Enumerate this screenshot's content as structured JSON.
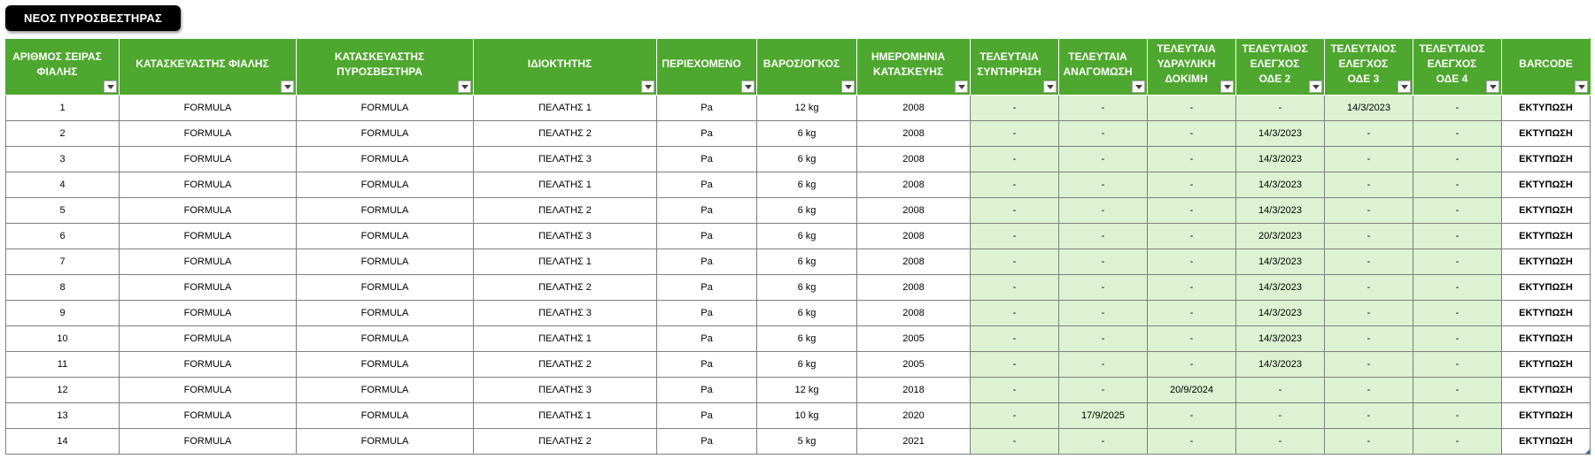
{
  "toolbar": {
    "new_button_label": "ΝΕΟΣ ΠΥΡΟΣΒΕΣΤΗΡΑΣ"
  },
  "colors": {
    "header_bg": "#4ea72e",
    "header_text": "#ffffff",
    "highlight_cell_bg": "#dcf2d0",
    "grid_line": "#7f7f7f",
    "button_bg": "#000000"
  },
  "icons": {
    "filter": "filter-dropdown-icon"
  },
  "table": {
    "columns": [
      "ΑΡΙΘΜΟΣ ΣΕΙΡΑΣ ΦΙΑΛΗΣ",
      "ΚΑΤΑΣΚΕΥΑΣΤΗΣ ΦΙΑΛΗΣ",
      "ΚΑΤΑΣΚΕΥΑΣΤΗΣ ΠΥΡΟΣΒΕΣΤΗΡΑ",
      "ΙΔΙΟΚΤΗΤΗΣ",
      "ΠΕΡΙΕΧΟΜΕΝΟ",
      "ΒΑΡΟΣ/ΟΓΚΟΣ",
      "ΗΜΕΡΟΜΗΝΙΑ ΚΑΤΑΣΚΕΥΗΣ",
      "ΤΕΛΕΥΤΑΙΑ ΣΥΝΤΗΡΗΣΗ",
      "ΤΕΛΕΥΤΑΙΑ ΑΝΑΓΟΜΩΣΗ",
      "ΤΕΛΕΥΤΑΙΑ ΥΔΡΑΥΛΙΚΗ ΔΟΚΙΜΗ",
      "ΤΕΛΕΥΤΑΙΟΣ ΕΛΕΓΧΟΣ ΟΔΕ 2",
      "ΤΕΛΕΥΤΑΙΟΣ ΕΛΕΓΧΟΣ ΟΔΕ 3",
      "ΤΕΛΕΥΤΑΙΟΣ ΕΛΕΓΧΟΣ ΟΔΕ 4",
      "BARCODE"
    ],
    "rows": [
      [
        "1",
        "FORMULA",
        "FORMULA",
        "ΠΕΛΑΤΗΣ 1",
        "Pa",
        "12 kg",
        "2008",
        "-",
        "-",
        "-",
        "-",
        "14/3/2023",
        "-",
        "ΕΚΤΥΠΩΣΗ"
      ],
      [
        "2",
        "FORMULA",
        "FORMULA",
        "ΠΕΛΑΤΗΣ 2",
        "Pa",
        "6 kg",
        "2008",
        "-",
        "-",
        "-",
        "14/3/2023",
        "-",
        "-",
        "ΕΚΤΥΠΩΣΗ"
      ],
      [
        "3",
        "FORMULA",
        "FORMULA",
        "ΠΕΛΑΤΗΣ 3",
        "Pa",
        "6 kg",
        "2008",
        "-",
        "-",
        "-",
        "14/3/2023",
        "-",
        "-",
        "ΕΚΤΥΠΩΣΗ"
      ],
      [
        "4",
        "FORMULA",
        "FORMULA",
        "ΠΕΛΑΤΗΣ 1",
        "Pa",
        "6 kg",
        "2008",
        "-",
        "-",
        "-",
        "14/3/2023",
        "-",
        "-",
        "ΕΚΤΥΠΩΣΗ"
      ],
      [
        "5",
        "FORMULA",
        "FORMULA",
        "ΠΕΛΑΤΗΣ 2",
        "Pa",
        "6 kg",
        "2008",
        "-",
        "-",
        "-",
        "14/3/2023",
        "-",
        "-",
        "ΕΚΤΥΠΩΣΗ"
      ],
      [
        "6",
        "FORMULA",
        "FORMULA",
        "ΠΕΛΑΤΗΣ 3",
        "Pa",
        "6 kg",
        "2008",
        "-",
        "-",
        "-",
        "20/3/2023",
        "-",
        "-",
        "ΕΚΤΥΠΩΣΗ"
      ],
      [
        "7",
        "FORMULA",
        "FORMULA",
        "ΠΕΛΑΤΗΣ 1",
        "Pa",
        "6 kg",
        "2008",
        "-",
        "-",
        "-",
        "14/3/2023",
        "-",
        "-",
        "ΕΚΤΥΠΩΣΗ"
      ],
      [
        "8",
        "FORMULA",
        "FORMULA",
        "ΠΕΛΑΤΗΣ 2",
        "Pa",
        "6 kg",
        "2008",
        "-",
        "-",
        "-",
        "14/3/2023",
        "-",
        "-",
        "ΕΚΤΥΠΩΣΗ"
      ],
      [
        "9",
        "FORMULA",
        "FORMULA",
        "ΠΕΛΑΤΗΣ 3",
        "Pa",
        "6 kg",
        "2008",
        "-",
        "-",
        "-",
        "14/3/2023",
        "-",
        "-",
        "ΕΚΤΥΠΩΣΗ"
      ],
      [
        "10",
        "FORMULA",
        "FORMULA",
        "ΠΕΛΑΤΗΣ 1",
        "Pa",
        "6 kg",
        "2005",
        "-",
        "-",
        "-",
        "14/3/2023",
        "-",
        "-",
        "ΕΚΤΥΠΩΣΗ"
      ],
      [
        "11",
        "FORMULA",
        "FORMULA",
        "ΠΕΛΑΤΗΣ 2",
        "Pa",
        "6 kg",
        "2005",
        "-",
        "-",
        "-",
        "14/3/2023",
        "-",
        "-",
        "ΕΚΤΥΠΩΣΗ"
      ],
      [
        "12",
        "FORMULA",
        "FORMULA",
        "ΠΕΛΑΤΗΣ 3",
        "Pa",
        "12 kg",
        "2018",
        "-",
        "-",
        "20/9/2024",
        "-",
        "-",
        "-",
        "ΕΚΤΥΠΩΣΗ"
      ],
      [
        "13",
        "FORMULA",
        "FORMULA",
        "ΠΕΛΑΤΗΣ 1",
        "Pa",
        "10 kg",
        "2020",
        "-",
        "17/9/2025",
        "-",
        "-",
        "-",
        "-",
        "ΕΚΤΥΠΩΣΗ"
      ],
      [
        "14",
        "FORMULA",
        "FORMULA",
        "ΠΕΛΑΤΗΣ 2",
        "Pa",
        "5 kg",
        "2021",
        "-",
        "-",
        "-",
        "-",
        "-",
        "-",
        "ΕΚΤΥΠΩΣΗ"
      ]
    ]
  }
}
